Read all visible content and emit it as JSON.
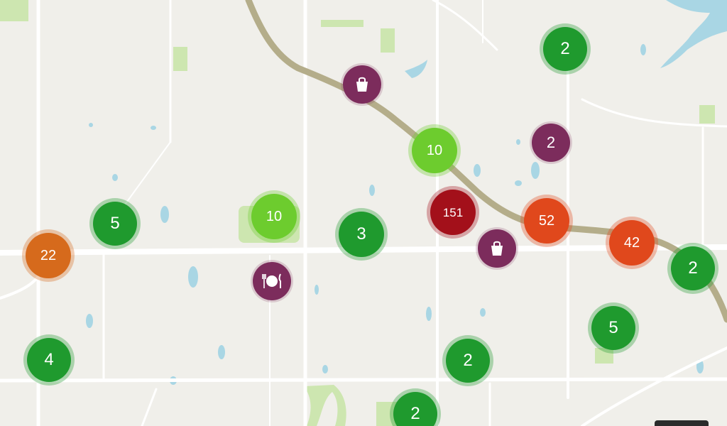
{
  "colors": {
    "background": "#f0efea",
    "road": "#ffffff",
    "highway": "#b4ad8a",
    "water": "#a9d6e4",
    "park": "#cde6b0",
    "cluster_small": "#1f9a2e",
    "cluster_small_light": "#6dcc2e",
    "cluster_medium": "#e0481c",
    "cluster_medium_alt": "#d66a1c",
    "cluster_large": "#a3101a",
    "poi": "#7c2c5c"
  },
  "clusters": [
    {
      "id": "c1",
      "label": "2",
      "tier": "small"
    },
    {
      "id": "c2",
      "label": "10",
      "tier": "small-light"
    },
    {
      "id": "c3",
      "label": "10",
      "tier": "small-light"
    },
    {
      "id": "c4",
      "label": "5",
      "tier": "small"
    },
    {
      "id": "c5",
      "label": "3",
      "tier": "small"
    },
    {
      "id": "c6",
      "label": "151",
      "tier": "large"
    },
    {
      "id": "c7",
      "label": "52",
      "tier": "medium"
    },
    {
      "id": "c8",
      "label": "42",
      "tier": "medium"
    },
    {
      "id": "c9",
      "label": "22",
      "tier": "medium-alt"
    },
    {
      "id": "c10",
      "label": "2",
      "tier": "small"
    },
    {
      "id": "c11",
      "label": "5",
      "tier": "small"
    },
    {
      "id": "c12",
      "label": "4",
      "tier": "small"
    },
    {
      "id": "c13",
      "label": "2",
      "tier": "small"
    },
    {
      "id": "c14",
      "label": "2",
      "tier": "small"
    }
  ],
  "pois": [
    {
      "id": "p1",
      "type": "shopping",
      "icon": "shopping-bag-icon"
    },
    {
      "id": "p2",
      "type": "count",
      "label": "2"
    },
    {
      "id": "p3",
      "type": "shopping",
      "icon": "shopping-bag-icon"
    },
    {
      "id": "p4",
      "type": "restaurant",
      "icon": "fork-knife-icon"
    }
  ]
}
